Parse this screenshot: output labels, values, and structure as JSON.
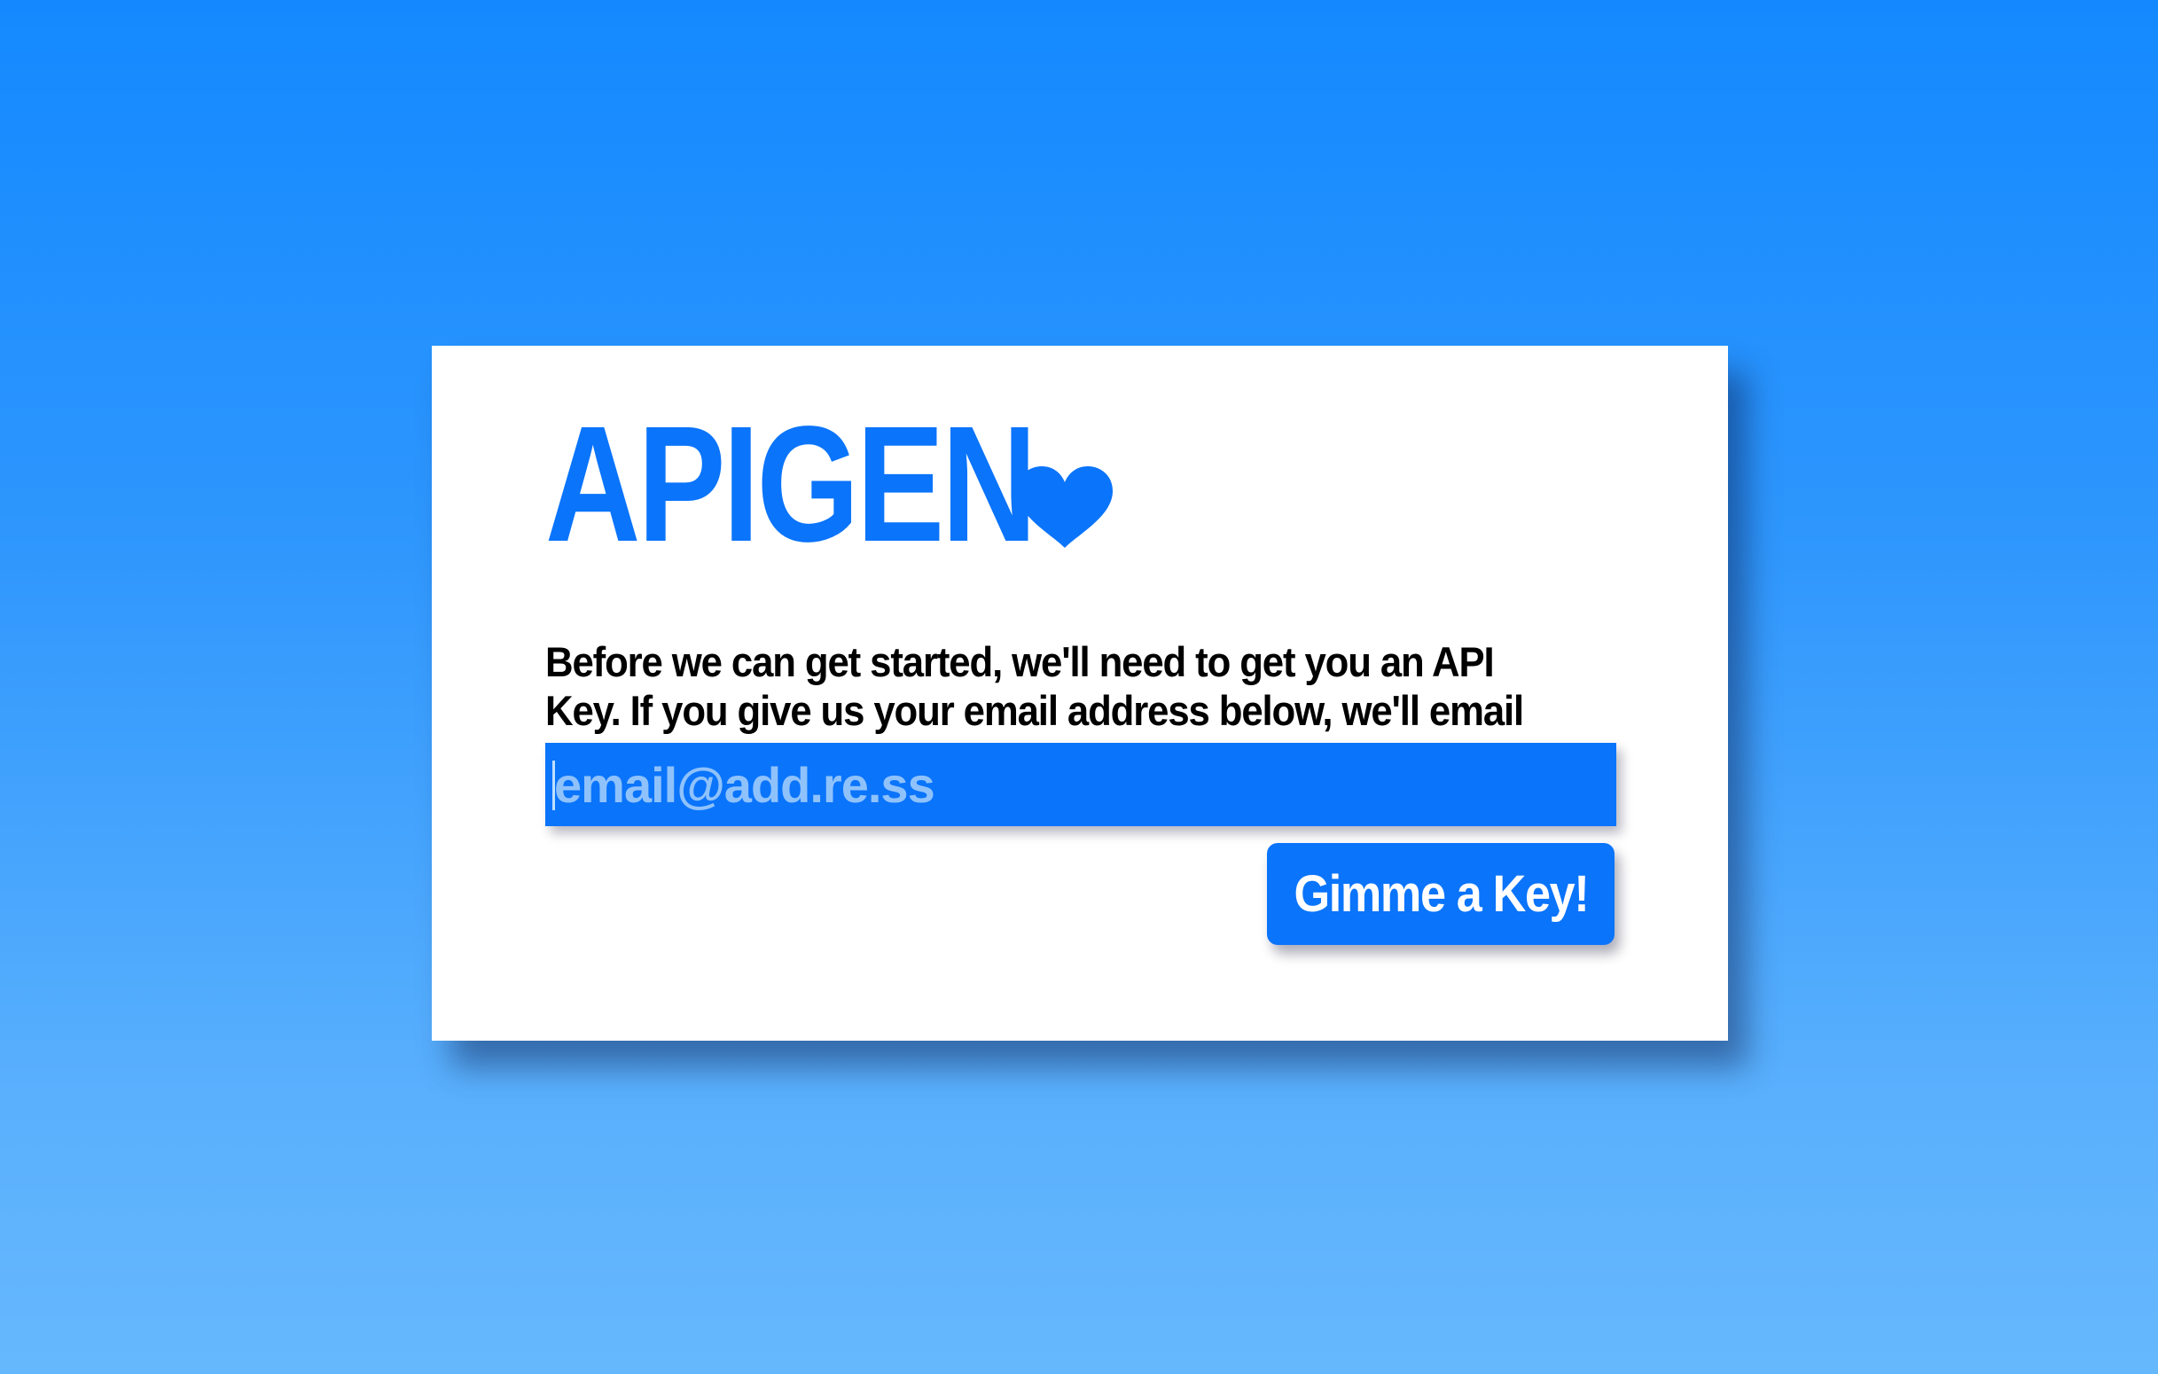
{
  "app": {
    "logo_text": "APIGEN",
    "logo_icon": "heart-icon",
    "brand_color": "#0a74fb"
  },
  "signup": {
    "intro_text": "Before we can get started, we'll need to get you an API Key. If you give us your email address below, we'll email you one!",
    "email": {
      "value": "",
      "placeholder": "email@add.re.ss"
    },
    "submit_label": "Gimme a Key!"
  }
}
